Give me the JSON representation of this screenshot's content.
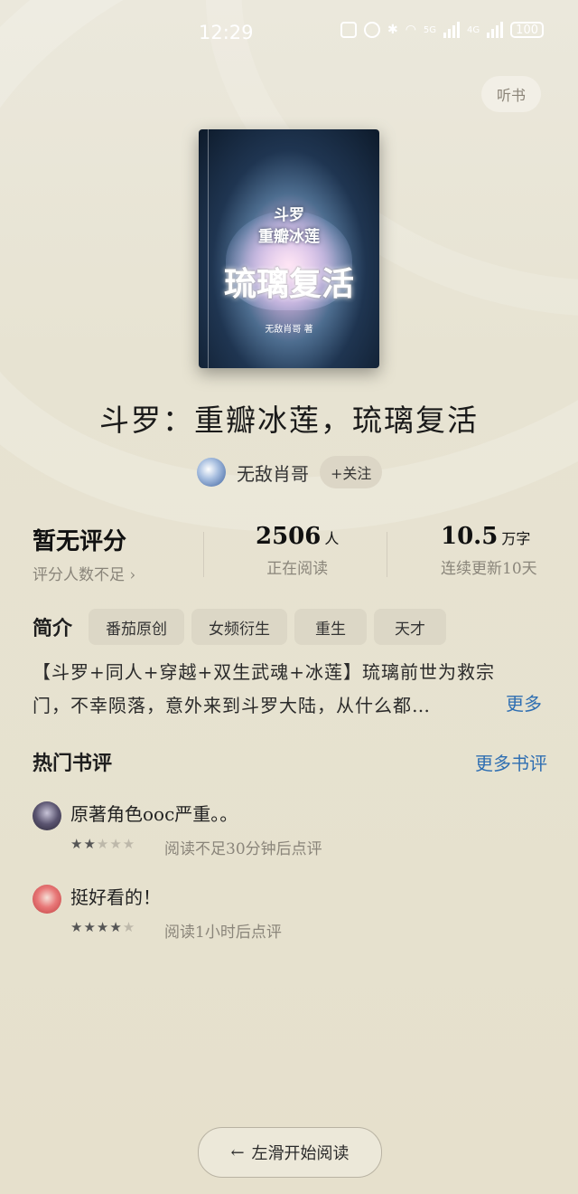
{
  "status_bar": {
    "time": "12:29",
    "network_5g": "5G",
    "network_4g": "4G",
    "battery": "100"
  },
  "listen_button": "听书",
  "cover": {
    "line1": "斗罗",
    "line2": "重瓣冰莲",
    "line3": "琉璃复活",
    "author_line": "无敌肖哥 著"
  },
  "book": {
    "title": "斗罗：重瓣冰莲，琉璃复活",
    "author": "无敌肖哥",
    "follow_label": "+关注"
  },
  "stats": {
    "rating_main": "暂无评分",
    "rating_sub": "评分人数不足",
    "readers_value": "2506",
    "readers_unit": "人",
    "readers_sub": "正在阅读",
    "words_value": "10.5",
    "words_unit": "万字",
    "words_sub": "连续更新10天"
  },
  "intro": {
    "label": "简介",
    "tags": [
      "番茄原创",
      "女频衍生",
      "重生",
      "天才"
    ],
    "text_line1": "【斗罗+同人+穿越+双生武魂+冰莲】琉璃前世为救宗",
    "text_line2": "门，不幸陨落，意外来到斗罗大陆，从什么都…",
    "more_label": "更多"
  },
  "reviews_section": {
    "title": "热门书评",
    "more_label": "更多书评",
    "reviews": [
      {
        "text": "原著角色ooc严重。。",
        "stars": 2,
        "note": "阅读不足30分钟后点评"
      },
      {
        "text": "挺好看的！",
        "stars": 4,
        "note": "阅读1小时后点评"
      }
    ]
  },
  "start_reading": "左滑开始阅读"
}
